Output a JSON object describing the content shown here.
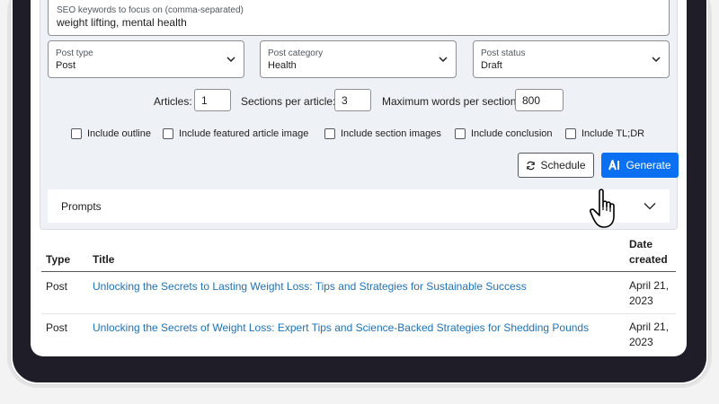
{
  "form": {
    "keywords": {
      "label": "SEO keywords to focus on (comma-separated)",
      "value": "weight lifting, mental health"
    },
    "selects": [
      {
        "label": "Post type",
        "value": "Post"
      },
      {
        "label": "Post category",
        "value": "Health"
      },
      {
        "label": "Post status",
        "value": "Draft"
      }
    ],
    "numbers": {
      "articles_label": "Articles:",
      "articles_value": "1",
      "sections_label": "Sections per article:",
      "sections_value": "3",
      "words_label": "Maximum words per section:",
      "words_value": "800"
    },
    "checkboxes": [
      {
        "label": "Include outline",
        "checked": false
      },
      {
        "label": "Include featured article image",
        "checked": false
      },
      {
        "label": "Include section images",
        "checked": false
      },
      {
        "label": "Include conclusion",
        "checked": false
      },
      {
        "label": "Include TL;DR",
        "checked": false
      }
    ],
    "schedule_label": "Schedule",
    "generate_label": "Generate",
    "prompts_label": "Prompts"
  },
  "table": {
    "headers": {
      "type": "Type",
      "title": "Title",
      "date": "Date created"
    },
    "rows": [
      {
        "type": "Post",
        "title": "Unlocking the Secrets to Lasting Weight Loss: Tips and Strategies for Sustainable Success",
        "date": "April 21, 2023"
      },
      {
        "type": "Post",
        "title": "Unlocking the Secrets of Weight Loss: Expert Tips and Science-Backed Strategies for Shedding Pounds",
        "date": "April 21, 2023"
      }
    ]
  },
  "colors": {
    "accent": "#0a6ff0",
    "link": "#2271b1",
    "bezel": "#1f1d28",
    "panel": "#eef2f6"
  },
  "icons": [
    "chevron-down-icon",
    "refresh-icon",
    "ai-icon",
    "hand-pointer-icon"
  ]
}
